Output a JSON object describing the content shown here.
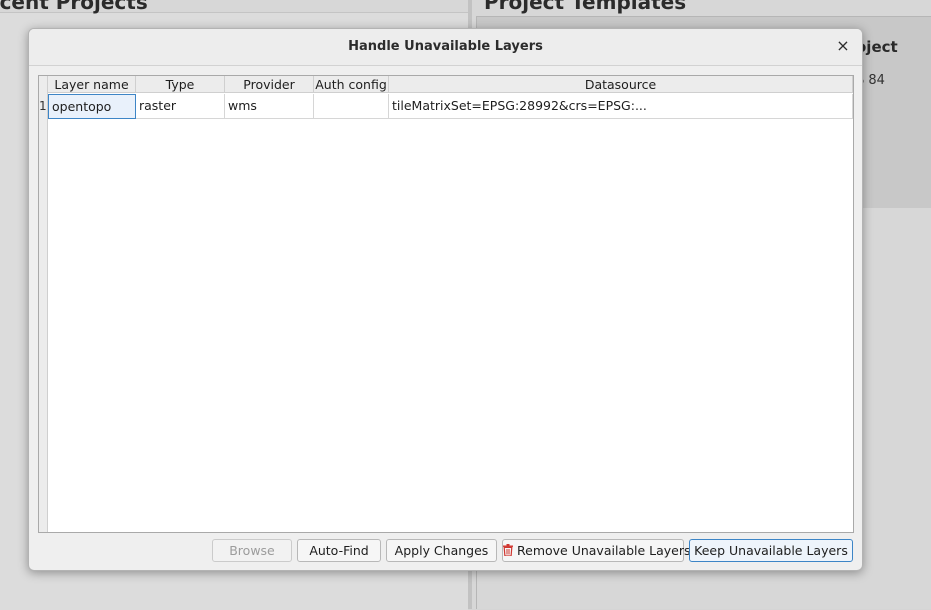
{
  "background": {
    "left_title": "ecent Projects",
    "right_title": "Project Templates",
    "card_title": "oject",
    "card_subtitle": "S 84"
  },
  "dialog": {
    "title": "Handle Unavailable Layers",
    "close_icon": "×",
    "table": {
      "columns": [
        "Layer name",
        "Type",
        "Provider",
        "Auth config",
        "Datasource"
      ],
      "rows": [
        {
          "number": "1",
          "layer_name": "opentopo",
          "type": "raster",
          "provider": "wms",
          "auth_config": "",
          "datasource": "tileMatrixSet=EPSG:28992&crs=EPSG:..."
        }
      ]
    },
    "buttons": {
      "browse": "Browse",
      "auto_find": "Auto-Find",
      "apply_changes": "Apply Changes",
      "remove_unavailable": "Remove Unavailable Layers",
      "keep_unavailable": "Keep Unavailable Layers"
    },
    "colors": {
      "accent": "#3d85c6",
      "trash_icon": "#d0352f"
    }
  }
}
